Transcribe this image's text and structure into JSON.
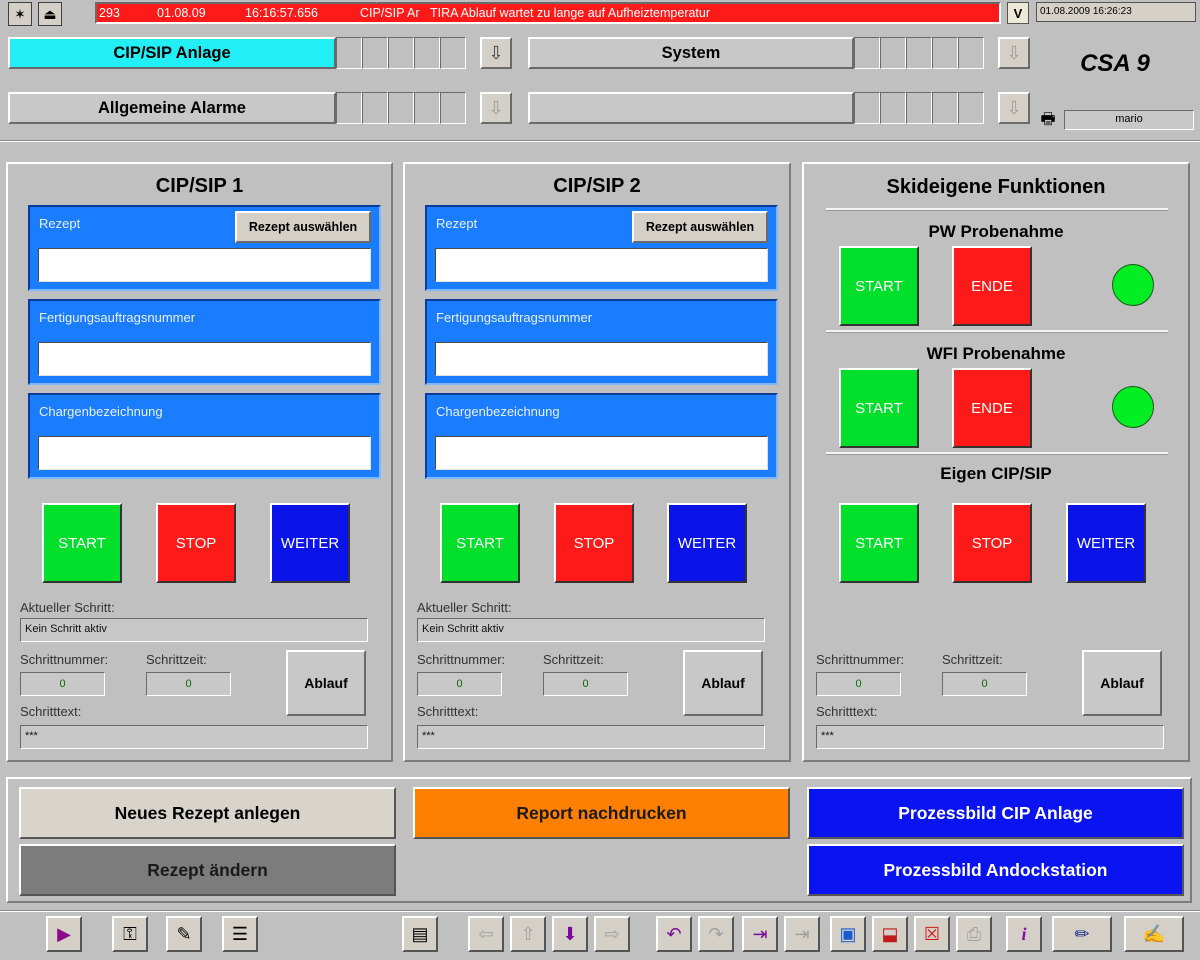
{
  "alarm": {
    "number": "293",
    "date": "01.08.09",
    "time": "16:16:57.656",
    "area": "CIP/SIP Ar",
    "message": "TIRA Ablauf wartet zu lange auf Aufheiztemperatur",
    "color": "#ff1a1a"
  },
  "header": {
    "datetime": "01.08.2009 16:26:23",
    "station": "CSA 9",
    "user": "mario",
    "rows": [
      {
        "left_label": "CIP/SIP Anlage",
        "left_active": true,
        "right_label": "System"
      },
      {
        "left_label": "Allgemeine Alarme",
        "left_active": false,
        "right_label": ""
      }
    ],
    "active_color": "#22eef6"
  },
  "panel1": {
    "title": "CIP/SIP 1",
    "rezept_label": "Rezept",
    "rezept_button": "Rezept auswählen",
    "rezept_value": "",
    "fa_label": "Fertigungsauftragsnummer",
    "fa_value": "",
    "charge_label": "Chargenbezeichnung",
    "charge_value": "",
    "start": "START",
    "stop": "STOP",
    "weiter": "WEITER",
    "step_label": "Aktueller Schritt:",
    "step_value": "Kein Schritt aktiv",
    "stepnr_label": "Schrittnummer:",
    "stepnr_value": "0",
    "steptime_label": "Schrittzeit:",
    "steptime_value": "0",
    "ablauf": "Ablauf",
    "steptext_label": "Schritttext:",
    "steptext_value": "***"
  },
  "panel2": {
    "title": "CIP/SIP 2",
    "rezept_label": "Rezept",
    "rezept_button": "Rezept auswählen",
    "rezept_value": "",
    "fa_label": "Fertigungsauftragsnummer",
    "fa_value": "",
    "charge_label": "Chargenbezeichnung",
    "charge_value": "",
    "start": "START",
    "stop": "STOP",
    "weiter": "WEITER",
    "step_label": "Aktueller Schritt:",
    "step_value": "Kein Schritt aktiv",
    "stepnr_label": "Schrittnummer:",
    "stepnr_value": "0",
    "steptime_label": "Schrittzeit:",
    "steptime_value": "0",
    "ablauf": "Ablauf",
    "steptext_label": "Schritttext:",
    "steptext_value": "***"
  },
  "panel3": {
    "title": "Skideigene Funktionen",
    "pw_title": "PW Probenahme",
    "pw_start": "START",
    "pw_ende": "ENDE",
    "wfi_title": "WFI Probenahme",
    "wfi_start": "START",
    "wfi_ende": "ENDE",
    "eigen_title": "Eigen CIP/SIP",
    "start": "START",
    "stop": "STOP",
    "weiter": "WEITER",
    "stepnr_label": "Schrittnummer:",
    "stepnr_value": "0",
    "steptime_label": "Schrittzeit:",
    "steptime_value": "0",
    "ablauf": "Ablauf",
    "steptext_label": "Schritttext:",
    "steptext_value": "***"
  },
  "actions": {
    "neues_rezept": "Neues Rezept anlegen",
    "rezept_aendern": "Rezept ändern",
    "report": "Report nachdrucken",
    "prozess_cip": "Prozessbild CIP Anlage",
    "prozess_andock": "Prozessbild Andockstation"
  },
  "toolbar": {
    "icons": [
      "play-icon",
      "key-icon",
      "notes-icon",
      "list-icon",
      "report-icon",
      "arrow-left-icon",
      "arrow-up-icon",
      "arrow-down-icon",
      "arrow-right-icon",
      "undo-icon",
      "redo-icon",
      "jump-icon",
      "jump-dim-icon",
      "screen-icon",
      "screen-arrow-icon",
      "screen-cross-icon",
      "screen-print-icon",
      "info-icon",
      "pen-icon",
      "signature-icon"
    ]
  }
}
